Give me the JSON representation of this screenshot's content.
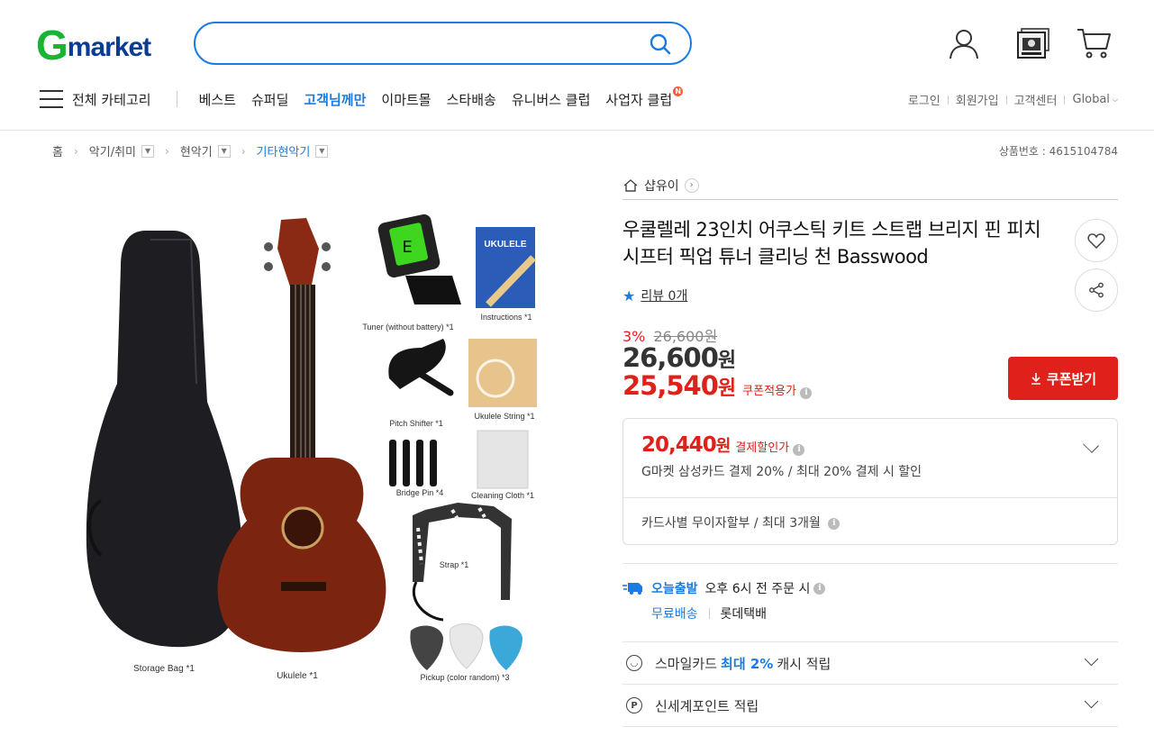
{
  "header": {
    "logo_g": "G",
    "logo_rest": "market",
    "search": {
      "value": "",
      "placeholder": ""
    },
    "icons": [
      "user-icon",
      "recent-viewed-icon",
      "cart-icon"
    ]
  },
  "nav": {
    "all_categories": "전체 카테고리",
    "items": [
      {
        "label": "베스트"
      },
      {
        "label": "슈퍼딜"
      },
      {
        "label": "고객님께만",
        "highlight": true
      },
      {
        "label": "이마트몰"
      },
      {
        "label": "스타배송"
      },
      {
        "label": "유니버스 클럽"
      },
      {
        "label": "사업자 클럽",
        "badge": "N"
      }
    ],
    "util": [
      "로그인",
      "회원가입",
      "고객센터",
      "Global"
    ]
  },
  "breadcrumb": {
    "home": "홈",
    "items": [
      "악기/취미",
      "현악기",
      "기타현악기"
    ]
  },
  "product_number": "상품번호 : 4615104784",
  "product": {
    "shop_name": "샵유이",
    "title": "우쿨렐레 23인치 어쿠스틱 키트 스트랩 브리지 핀 피치 시프터 픽업 튜너 클리닝 천 Basswood",
    "review": "리뷰 0개",
    "discount_pct": "3%",
    "original_price": "26,600원",
    "price_amount": "26,600",
    "price_unit": "원",
    "coupon_price_amount": "25,540",
    "coupon_price_unit": "원",
    "coupon_price_label": "쿠폰적용가",
    "coupon_button": "쿠폰받기",
    "card_price_amount": "20,440",
    "card_price_unit": "원",
    "card_price_label": "결제할인가",
    "card_desc": "G마켓 삼성카드 결제 20% / 최대 20% 결제 시 할인",
    "installment": "카드사별 무이자할부 / 최대 3개월",
    "shipping_today": "오늘출발",
    "shipping_time": "오후 6시 전 주문 시",
    "free_shipping": "무료배송",
    "courier": "롯데택배",
    "smile_card_prefix": "스마일카드",
    "smile_card_highlight": "최대 2%",
    "smile_card_suffix": "캐시 적립",
    "shinsegae_points": "신세계포인트 적립"
  },
  "image_labels": {
    "storage_bag": "Storage Bag *1",
    "ukulele": "Ukulele *1",
    "tuner": "Tuner (without battery) *1",
    "instructions": "Instructions *1",
    "instructions_cover": "UKULELE",
    "pitch_shifter": "Pitch Shifter *1",
    "ukulele_string": "Ukulele String *1",
    "bridge_pin": "Bridge Pin *4",
    "cleaning_cloth": "Cleaning Cloth *1",
    "strap": "Strap *1",
    "pickup": "Pickup (color random) *3",
    "tuner_display": "E"
  },
  "colors": {
    "brand_green": "#19b434",
    "brand_navy": "#0a3d92",
    "accent_blue": "#1d7be0",
    "sale_red": "#e0201a"
  }
}
